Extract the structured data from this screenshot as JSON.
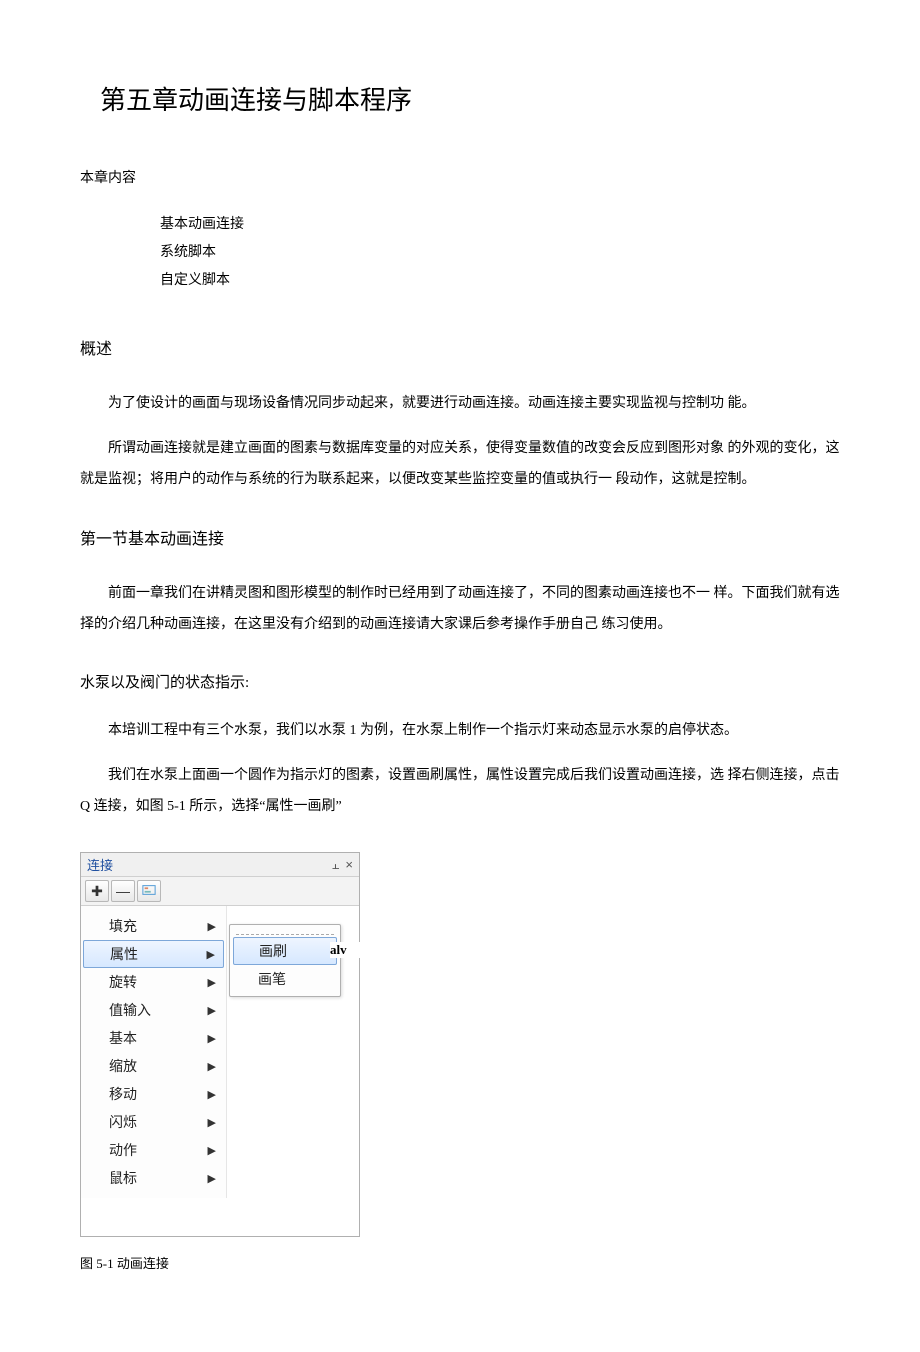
{
  "chapterTitle": "第五章动画连接与脚本程序",
  "sectionLabel": "本章内容",
  "contentsList": [
    "基本动画连接",
    "系统脚本",
    "自定义脚本"
  ],
  "overviewHeading": "概述",
  "overviewP1": "为了使设计的画面与现场设备情况同步动起来，就要进行动画连接。动画连接主要实现监视与控制功 能。",
  "overviewP2": "所谓动画连接就是建立画面的图素与数据库变量的对应关系，使得变量数值的改变会反应到图形对象 的外观的变化，这就是监视；将用户的动作与系统的行为联系起来，以便改变某些监控变量的值或执行一 段动作，这就是控制。",
  "s1Heading": "第一节基本动画连接",
  "s1P1": "前面一章我们在讲精灵图和图形模型的制作时已经用到了动画连接了，不同的图素动画连接也不一 样。下面我们就有选择的介绍几种动画连接，在这里没有介绍到的动画连接请大家课后参考操作手册自己 练习使用。",
  "sub1Heading": "水泵以及阀门的状态指示:",
  "sub1P1": "本培训工程中有三个水泵，我们以水泵 1 为例，在水泵上制作一个指示灯来动态显示水泵的启停状态。",
  "sub1P2": "我们在水泵上面画一个圆作为指示灯的图素，设置画刷属性，属性设置完成后我们设置动画连接，选 择右侧连接，点击 Q 连接，如图 5-1 所示，选择“属性一画刷”",
  "figureCaption": "图 5-1 动画连接",
  "ui": {
    "panelTitle": "连接",
    "pinGlyph": "⫠",
    "closeGlyph": "×",
    "plusGlyph": "✚",
    "minusGlyph": "—",
    "menu": {
      "items": [
        "填充",
        "属性",
        "旋转",
        "值输入",
        "基本",
        "缩放",
        "移动",
        "闪烁",
        "动作",
        "鼠标"
      ],
      "selectedIndex": 1
    },
    "submenu": {
      "items": [
        "画刷",
        "画笔"
      ],
      "selectedIndex": 0
    },
    "rightText": "alv"
  }
}
